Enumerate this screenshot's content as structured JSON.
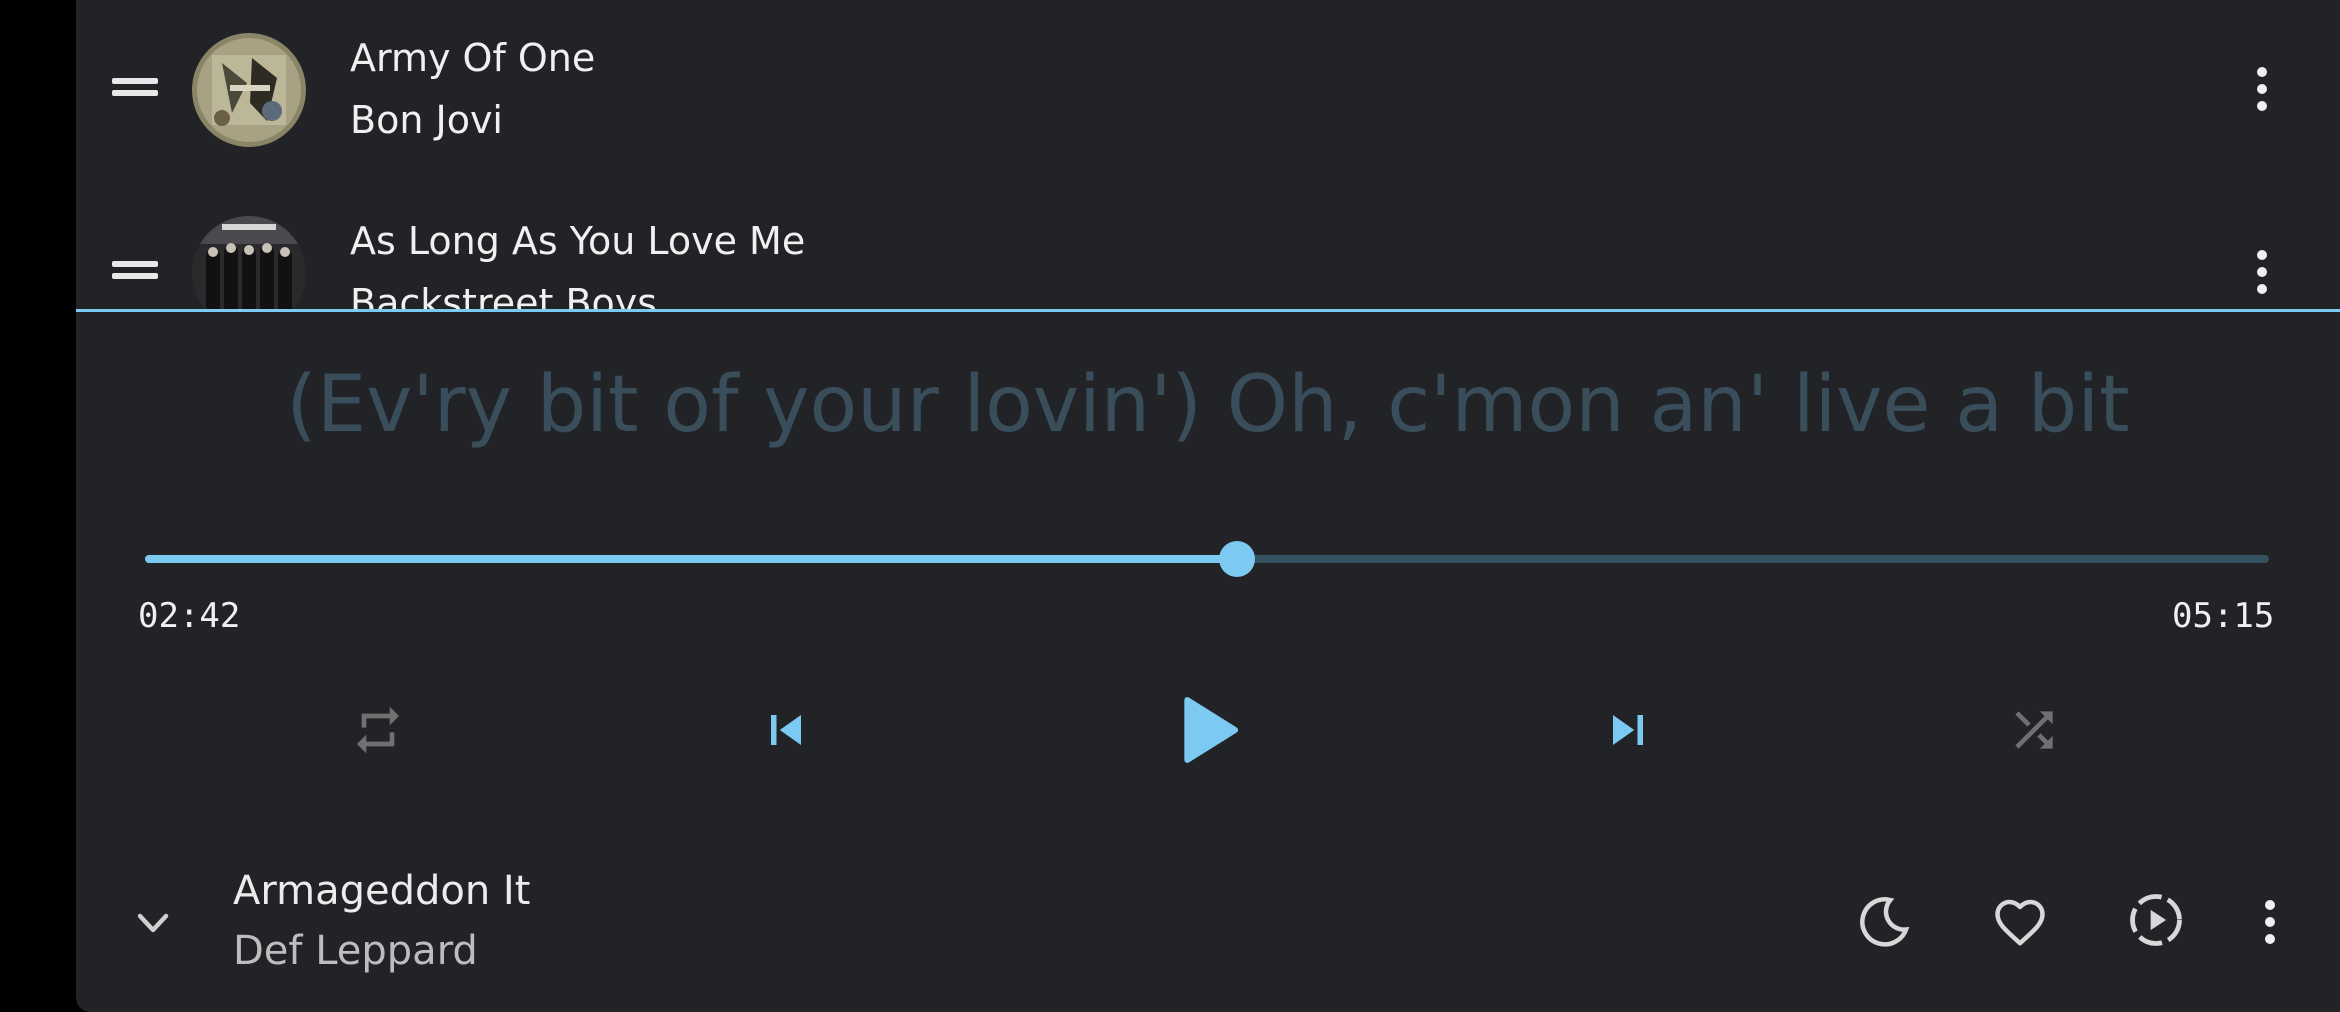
{
  "queue": [
    {
      "title": "Army Of One",
      "artist": "Bon Jovi",
      "art_icon": "album-art-army-of-one"
    },
    {
      "title": "As Long As You Love Me",
      "artist": "Backstreet Boys",
      "art_icon": "album-art-backstreet-boys"
    }
  ],
  "lyrics": {
    "current_line": "(Ev'ry bit of your lovin') Oh, c'mon an' live a bit"
  },
  "player": {
    "position": "02:42",
    "duration": "05:15",
    "progress": 0.5141,
    "repeat_icon": "repeat-icon",
    "shuffle_icon": "shuffle-icon",
    "state": "paused"
  },
  "now_playing": {
    "title": "Armageddon It",
    "artist": "Def Leppard"
  },
  "colors": {
    "accent": "#7cc9f2",
    "background": "#222327",
    "lyric": "#3a4d5a",
    "inactive": "#707070"
  }
}
